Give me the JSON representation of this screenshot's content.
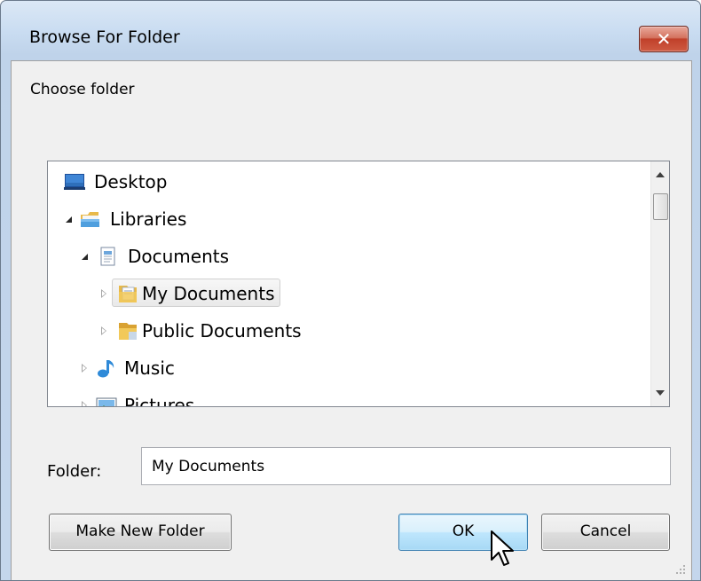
{
  "window": {
    "title": "Browse For Folder",
    "close_glyph": "✕"
  },
  "dialog": {
    "instruction": "Choose folder"
  },
  "tree": {
    "items": [
      {
        "label": "Desktop",
        "icon": "desktop-icon",
        "expander": "none",
        "level": 0
      },
      {
        "label": "Libraries",
        "icon": "libraries-icon",
        "expander": "open",
        "level": 0
      },
      {
        "label": "Documents",
        "icon": "documents-icon",
        "expander": "open",
        "level": 1
      },
      {
        "label": "My Documents",
        "icon": "folder-documents-icon",
        "expander": "closed",
        "level": 2,
        "selected": true
      },
      {
        "label": "Public Documents",
        "icon": "folder-public-icon",
        "expander": "closed",
        "level": 2
      },
      {
        "label": "Music",
        "icon": "music-icon",
        "expander": "closed",
        "level": 1
      },
      {
        "label": "Pictures",
        "icon": "pictures-icon",
        "expander": "closed",
        "level": 1
      }
    ]
  },
  "folder": {
    "label": "Folder:",
    "value": "My Documents"
  },
  "buttons": {
    "make_new_folder": "Make New Folder",
    "ok": "OK",
    "cancel": "Cancel"
  },
  "colors": {
    "close_button": "#c7462f",
    "default_button_border": "#3c7fb1",
    "selection_bg": "#e9e9e9"
  }
}
